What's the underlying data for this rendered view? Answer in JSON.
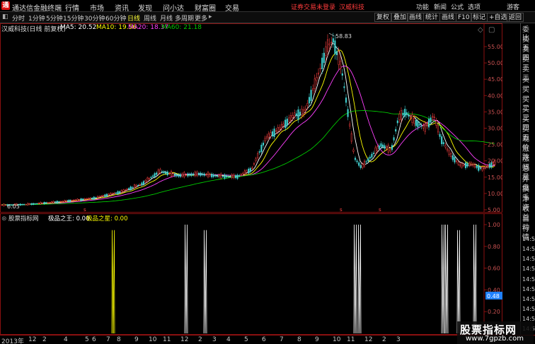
{
  "app": {
    "title": "通达信金融终端"
  },
  "menu": [
    "行情",
    "市场",
    "资讯",
    "发现",
    "问小达",
    "财富圈",
    "交易"
  ],
  "alerts": {
    "trade_login": "证券交易未登录",
    "stock_name": "汉威科技"
  },
  "right_menu": [
    "功能",
    "新闻",
    "公式",
    "选项",
    "游客"
  ],
  "toolbar": {
    "periods": [
      "分时",
      "1分钟",
      "5分钟",
      "15分钟",
      "30分钟",
      "60分钟",
      "日线",
      "周线",
      "月线",
      "多周期",
      "更多"
    ],
    "active_period": "日线",
    "right_buttons": [
      "复权",
      "叠加",
      "画线",
      "统计",
      "画线",
      "F10",
      "标记",
      "+自选",
      "返回"
    ]
  },
  "info": {
    "stock": "汉威科技(日线 前复权)",
    "ma5": "MA5: 20.52",
    "ma10": "MA10: 19.56",
    "ma20": "MA20: 18.37",
    "ma60": "MA60: 21.18"
  },
  "colors": {
    "ma5": "#ffffff",
    "ma10": "#ffff00",
    "ma20": "#ff40ff",
    "ma60": "#00c800",
    "frame": "#8a1010",
    "up": "#ff4040",
    "down": "#40d0d0"
  },
  "price_axis": [
    "55.00",
    "50.00",
    "45.00",
    "40.00",
    "35.00",
    "30.00",
    "25.00",
    "20.00",
    "15.00",
    "10.00",
    "5.00"
  ],
  "annotations": {
    "high": "58.83",
    "low": "6.05"
  },
  "indicator": {
    "name": "股票指标网",
    "line1": "极品之王: 0.00",
    "line2": "极品之星: 0.00",
    "axis": [
      "1.00",
      "0.80",
      "0.60",
      "0.40",
      "0.20"
    ],
    "current": "0.48"
  },
  "right_panel": [
    "委比",
    "卖五",
    "卖四",
    "卖三",
    "卖二",
    "卖一",
    "买一",
    "买二",
    "买三",
    "买四",
    "买五",
    "现价",
    "涨跌",
    "涨幅",
    "总量",
    "外盘",
    "换手",
    "净资",
    "收益",
    "自动",
    "行情",
    "14:50",
    "14:50",
    "14:50",
    "14:50",
    "14:50",
    "14:50",
    "14:50",
    "14:50",
    "14:50",
    "14:50"
  ],
  "timeline": [
    "2013年",
    "12",
    "2",
    "4",
    "5",
    "6",
    "7",
    "8",
    "9",
    "10",
    "11",
    "12",
    "2",
    "3",
    "4",
    "5",
    "6",
    "7",
    "8",
    "9",
    "10",
    "11",
    "12",
    "2",
    "3"
  ],
  "watermark": {
    "main": "股票指标网",
    "sub": "www.7gpzb.com"
  }
}
